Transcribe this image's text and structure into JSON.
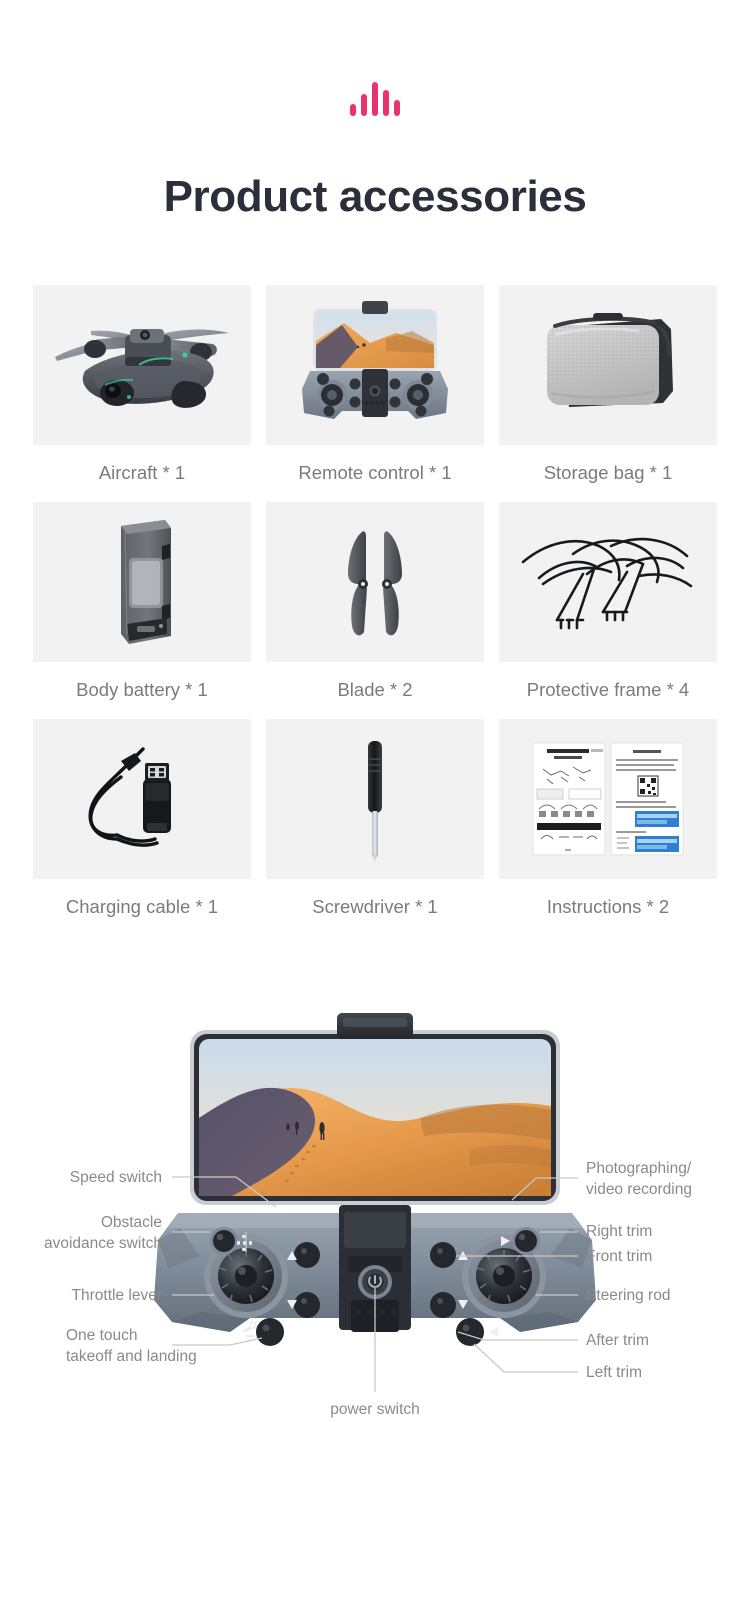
{
  "brand": {
    "logo_name": "sound-wave-logo",
    "accent_color": "#e8336e",
    "bars": [
      12,
      22,
      34,
      26,
      16
    ]
  },
  "header": {
    "title": "Product accessories",
    "title_color": "#2b2f3a"
  },
  "accessories": {
    "tile_bg": "#f2f2f2",
    "caption_color": "#7b7b7b",
    "items": [
      {
        "icon": "drone-aircraft-icon",
        "label": "Aircraft * 1"
      },
      {
        "icon": "remote-control-icon",
        "label": "Remote control * 1"
      },
      {
        "icon": "storage-bag-icon",
        "label": "Storage bag * 1"
      },
      {
        "icon": "battery-pack-icon",
        "label": "Body battery * 1"
      },
      {
        "icon": "propeller-blade-icon",
        "label": "Blade * 2"
      },
      {
        "icon": "protective-frame-icon",
        "label": "Protective frame * 4"
      },
      {
        "icon": "charging-cable-icon",
        "label": "Charging cable * 1"
      },
      {
        "icon": "screwdriver-icon",
        "label": "Screwdriver * 1"
      },
      {
        "icon": "instruction-manual-icon",
        "label": "Instructions * 2"
      }
    ]
  },
  "diagram": {
    "name": "remote-control-callout-diagram",
    "line_color": "#c8c8c8",
    "label_color": "#8a8a8a",
    "left_labels": [
      {
        "key": "speed-switch",
        "text": "Speed switch"
      },
      {
        "key": "obstacle-avoidance-switch",
        "text": "Obstacle\navoidance switch"
      },
      {
        "key": "throttle-lever",
        "text": "Throttle lever"
      },
      {
        "key": "one-touch-takeoff",
        "text": "One touch\ntakeoff and landing"
      }
    ],
    "right_labels": [
      {
        "key": "photographing-video",
        "text": "Photographing/\nvideo recording"
      },
      {
        "key": "right-trim",
        "text": "Right trim"
      },
      {
        "key": "front-trim",
        "text": "Front trim"
      },
      {
        "key": "steering-rod",
        "text": "Steering rod"
      },
      {
        "key": "after-trim",
        "text": "After trim"
      },
      {
        "key": "left-trim",
        "text": "Left trim"
      }
    ],
    "bottom_labels": [
      {
        "key": "power-switch",
        "text": "power switch"
      }
    ],
    "screen_scene": "desert-dunes-hikers"
  }
}
